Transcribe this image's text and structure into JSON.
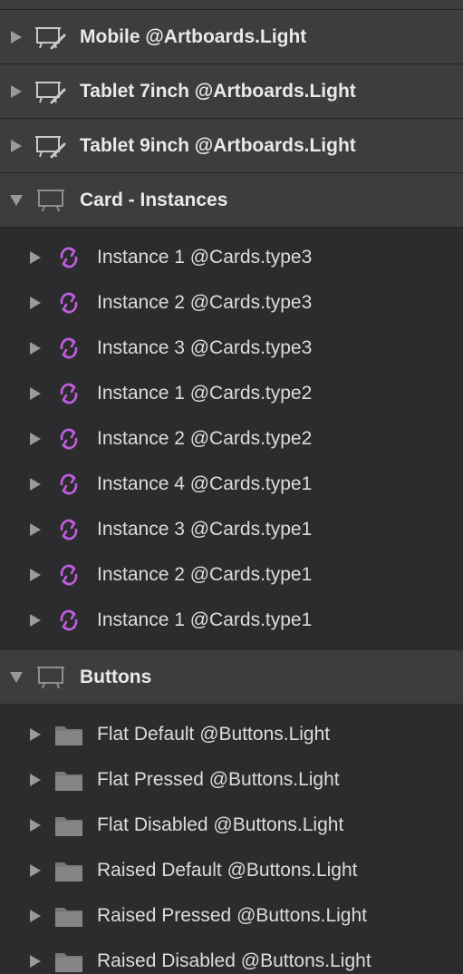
{
  "layers_panel": {
    "accent_symbol_color": "#c05ee0",
    "groups": [
      {
        "name": "Mobile @Artboards.Light",
        "expanded": false,
        "icon": "artboard-edit-icon",
        "children": []
      },
      {
        "name": "Tablet 7inch @Artboards.Light",
        "expanded": false,
        "icon": "artboard-edit-icon",
        "children": []
      },
      {
        "name": "Tablet 9inch @Artboards.Light",
        "expanded": false,
        "icon": "artboard-edit-icon",
        "children": []
      },
      {
        "name": "Card - Instances",
        "expanded": true,
        "icon": "artboard-icon",
        "children": [
          {
            "name": "Instance 1 @Cards.type3",
            "icon": "symbol-instance-icon"
          },
          {
            "name": "Instance 2 @Cards.type3",
            "icon": "symbol-instance-icon"
          },
          {
            "name": "Instance 3 @Cards.type3",
            "icon": "symbol-instance-icon"
          },
          {
            "name": "Instance 1 @Cards.type2",
            "icon": "symbol-instance-icon"
          },
          {
            "name": "Instance 2 @Cards.type2",
            "icon": "symbol-instance-icon"
          },
          {
            "name": "Instance 4 @Cards.type1",
            "icon": "symbol-instance-icon"
          },
          {
            "name": "Instance 3 @Cards.type1",
            "icon": "symbol-instance-icon"
          },
          {
            "name": "Instance 2 @Cards.type1",
            "icon": "symbol-instance-icon"
          },
          {
            "name": "Instance 1 @Cards.type1",
            "icon": "symbol-instance-icon"
          }
        ]
      },
      {
        "name": "Buttons",
        "expanded": true,
        "icon": "artboard-icon",
        "children": [
          {
            "name": "Flat Default @Buttons.Light",
            "icon": "folder-icon"
          },
          {
            "name": "Flat Pressed @Buttons.Light",
            "icon": "folder-icon"
          },
          {
            "name": "Flat Disabled @Buttons.Light",
            "icon": "folder-icon"
          },
          {
            "name": "Raised Default @Buttons.Light",
            "icon": "folder-icon"
          },
          {
            "name": "Raised Pressed @Buttons.Light",
            "icon": "folder-icon"
          },
          {
            "name": "Raised Disabled @Buttons.Light",
            "icon": "folder-icon"
          }
        ]
      }
    ]
  }
}
